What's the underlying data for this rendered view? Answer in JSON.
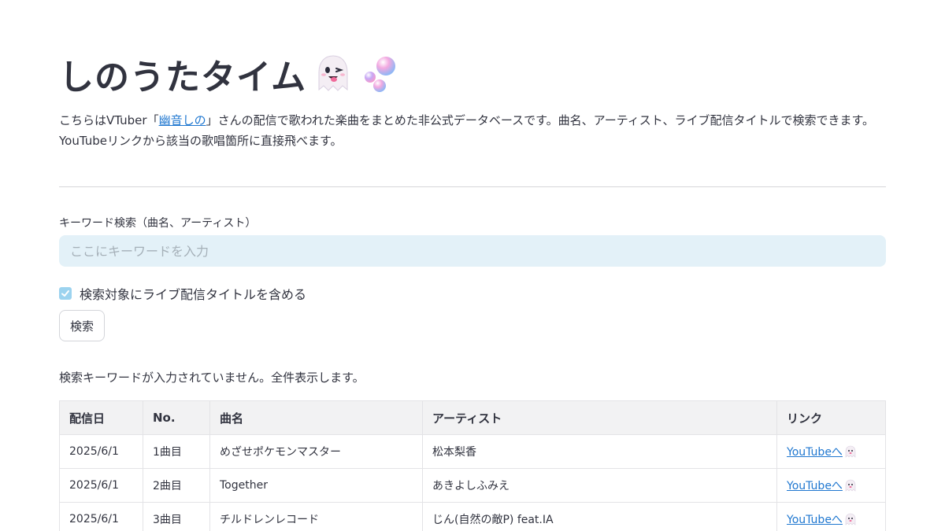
{
  "header": {
    "title": "しのうたタイム",
    "title_icons": [
      "ghost-icon",
      "bubbles-icon"
    ]
  },
  "description": {
    "prefix": "こちらはVTuber「",
    "link_text": "幽音しの",
    "suffix": "」さんの配信で歌われた楽曲をまとめた非公式データベースです。曲名、アーティスト、ライブ配信タイトルで検索できます。YouTubeリンクから該当の歌唱箇所に直接飛べます。"
  },
  "search": {
    "label": "キーワード検索（曲名、アーティスト）",
    "placeholder": "ここにキーワードを入力",
    "value": "",
    "include_title_label": "検索対象にライブ配信タイトルを含める",
    "include_title_checked": true,
    "button_label": "検索"
  },
  "status_message": "検索キーワードが入力されていません。全件表示します。",
  "table": {
    "headers": [
      "配信日",
      "No.",
      "曲名",
      "アーティスト",
      "リンク"
    ],
    "rows": [
      {
        "date": "2025/6/1",
        "no": "1曲目",
        "song": "めざせポケモンマスター",
        "artist": "松本梨香",
        "link": "YouTubeへ"
      },
      {
        "date": "2025/6/1",
        "no": "2曲目",
        "song": "Together",
        "artist": "あきよしふみえ",
        "link": "YouTubeへ"
      },
      {
        "date": "2025/6/1",
        "no": "3曲目",
        "song": "チルドレンレコード",
        "artist": "じん(自然の敵P) feat.IA",
        "link": "YouTubeへ"
      }
    ]
  },
  "colors": {
    "accent_link": "#1f77d0",
    "input_bg": "#e3f1f8",
    "checkbox": "#9cd3ef"
  }
}
